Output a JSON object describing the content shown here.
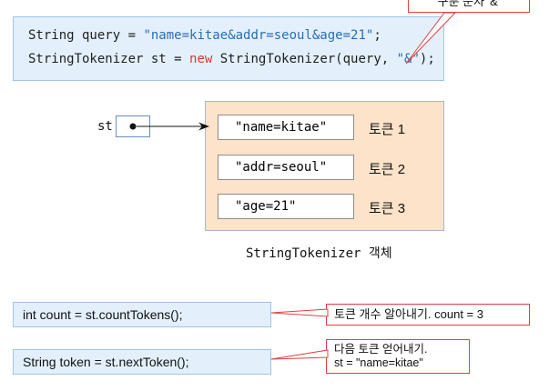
{
  "code": {
    "line1": {
      "a": "String query = ",
      "b": "\"name=kitae&addr=seoul&age=21\"",
      "c": ";"
    },
    "line2": {
      "a": "StringTokenizer st = ",
      "b": "new",
      "c": " StringTokenizer(query, ",
      "d": "\"&\"",
      "e": ");"
    }
  },
  "delimiter_callout": "구분 문자 '&'",
  "var_label": "st",
  "tokens": [
    {
      "value": "\"name=kitae\"",
      "label": "토큰 1"
    },
    {
      "value": "\"addr=seoul\"",
      "label": "토큰 2"
    },
    {
      "value": "\"age=21\"",
      "label": "토큰 3"
    }
  ],
  "object_caption": "StringTokenizer 객체",
  "statements": [
    {
      "code": "int count = st.countTokens();",
      "note_lines": [
        "토큰 개수 알아내기.  count = 3"
      ]
    },
    {
      "code": "String token = st.nextToken();",
      "note_lines": [
        "다음 토큰 얻어내기.",
        "st = \"name=kitae\""
      ]
    }
  ],
  "colors": {
    "code_bg": "#e3f0fb",
    "string": "#2a6db5",
    "keyword": "#d9382f",
    "object_bg": "#fce3c9",
    "callout_border": "#e04040"
  }
}
